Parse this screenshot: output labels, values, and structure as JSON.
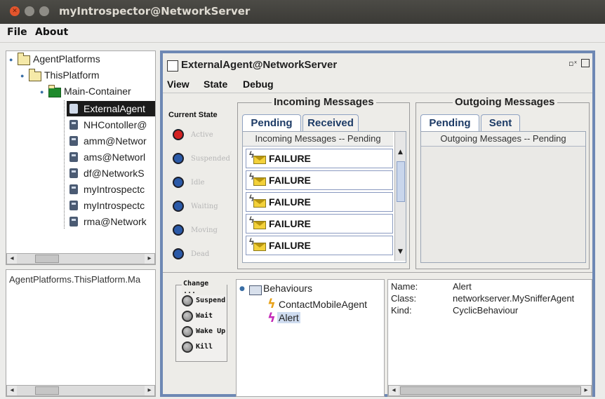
{
  "window": {
    "title": "myIntrospector@NetworkServer"
  },
  "menubar": {
    "file": "File",
    "about": "About"
  },
  "tree": {
    "root": "AgentPlatforms",
    "platform": "ThisPlatform",
    "container": "Main-Container",
    "agents": [
      "ExternalAgent",
      "NHContoller@",
      "amm@Networ",
      "ams@Networl",
      "df@NetworkS",
      "myIntrospectc",
      "myIntrospectc",
      "rma@Network"
    ]
  },
  "status_path": "AgentPlatforms.ThisPlatform.Ma",
  "frame": {
    "title": "ExternalAgent@NetworkServer",
    "menus": [
      "View",
      "State",
      "Debug"
    ],
    "current_state": {
      "title": "Current State",
      "states": [
        {
          "label": "Active",
          "color": "#d32222"
        },
        {
          "label": "Suspended",
          "color": "#2b5aa8"
        },
        {
          "label": "Idle",
          "color": "#2b5aa8"
        },
        {
          "label": "Waiting",
          "color": "#2b5aa8"
        },
        {
          "label": "Moving",
          "color": "#2b5aa8"
        },
        {
          "label": "Dead",
          "color": "#2b5aa8"
        }
      ]
    },
    "incoming": {
      "title": "Incoming Messages",
      "tabs": [
        "Pending",
        "Received"
      ],
      "header": "Incoming Messages -- Pending",
      "rows": [
        "FAILURE",
        "FAILURE",
        "FAILURE",
        "FAILURE",
        "FAILURE"
      ]
    },
    "outgoing": {
      "title": "Outgoing Messages",
      "tabs": [
        "Pending",
        "Sent"
      ],
      "header": "Outgoing Messages -- Pending"
    },
    "change": {
      "title": "Change ...",
      "buttons": [
        "Suspend",
        "Wait",
        "Wake Up",
        "Kill"
      ]
    },
    "behaviours": {
      "root": "Behaviours",
      "items": [
        "ContactMobileAgent",
        "Alert"
      ]
    },
    "details": {
      "name_label": "Name:",
      "name_value": "Alert",
      "class_label": "Class:",
      "class_value": "networkserver.MySnifferAgent",
      "kind_label": "Kind:",
      "kind_value": "CyclicBehaviour"
    }
  }
}
